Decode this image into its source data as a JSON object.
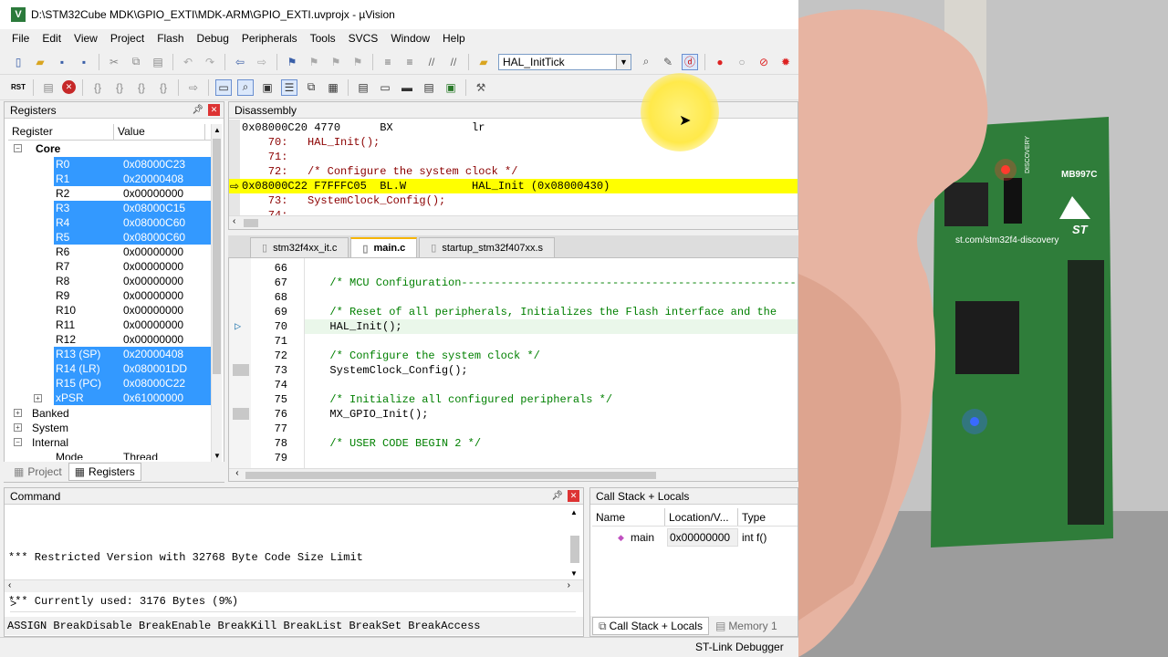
{
  "window": {
    "title": "D:\\STM32Cube MDK\\GPIO_EXTI\\MDK-ARM\\GPIO_EXTI.uvprojx - µVision",
    "app_icon": "V"
  },
  "menu": [
    "File",
    "Edit",
    "View",
    "Project",
    "Flash",
    "Debug",
    "Peripherals",
    "Tools",
    "SVCS",
    "Window",
    "Help"
  ],
  "toolbar": {
    "target_combo": "HAL_InitTick"
  },
  "registers": {
    "panel_title": "Registers",
    "col_register": "Register",
    "col_value": "Value",
    "group": "Core",
    "rows": [
      {
        "name": "R0",
        "value": "0x08000C23",
        "selected": true
      },
      {
        "name": "R1",
        "value": "0x20000408",
        "selected": true
      },
      {
        "name": "R2",
        "value": "0x00000000",
        "selected": false
      },
      {
        "name": "R3",
        "value": "0x08000C15",
        "selected": true
      },
      {
        "name": "R4",
        "value": "0x08000C60",
        "selected": true
      },
      {
        "name": "R5",
        "value": "0x08000C60",
        "selected": true
      },
      {
        "name": "R6",
        "value": "0x00000000",
        "selected": false
      },
      {
        "name": "R7",
        "value": "0x00000000",
        "selected": false
      },
      {
        "name": "R8",
        "value": "0x00000000",
        "selected": false
      },
      {
        "name": "R9",
        "value": "0x00000000",
        "selected": false
      },
      {
        "name": "R10",
        "value": "0x00000000",
        "selected": false
      },
      {
        "name": "R11",
        "value": "0x00000000",
        "selected": false
      },
      {
        "name": "R12",
        "value": "0x00000000",
        "selected": false
      },
      {
        "name": "R13 (SP)",
        "value": "0x20000408",
        "selected": true
      },
      {
        "name": "R14 (LR)",
        "value": "0x080001DD",
        "selected": true
      },
      {
        "name": "R15 (PC)",
        "value": "0x08000C22",
        "selected": true
      },
      {
        "name": "xPSR",
        "value": "0x61000000",
        "selected": true
      }
    ],
    "groups": [
      "Banked",
      "System",
      "Internal"
    ],
    "mode_label": "Mode",
    "mode_value": "Thread",
    "tabs": [
      "Project",
      "Registers"
    ]
  },
  "disassembly": {
    "title": "Disassembly",
    "lines": [
      "0x08000C20 4770      BX            lr",
      "    70:   HAL_Init();",
      "    71:",
      "    72:   /* Configure the system clock */",
      "0x08000C22 F7FFFC05  BL.W          HAL_Init (0x08000430)",
      "    73:   SystemClock_Config();",
      "    74:"
    ]
  },
  "editor": {
    "tabs": [
      "stm32f4xx_it.c",
      "main.c",
      "startup_stm32f407xx.s"
    ],
    "active_tab": "main.c",
    "lines": [
      {
        "n": "66",
        "code": ""
      },
      {
        "n": "67",
        "code": "  /* MCU Configuration----------------------------------------------------------"
      },
      {
        "n": "68",
        "code": ""
      },
      {
        "n": "69",
        "code": "  /* Reset of all peripherals, Initializes the Flash interface and the"
      },
      {
        "n": "70",
        "code": "  HAL_Init();"
      },
      {
        "n": "71",
        "code": ""
      },
      {
        "n": "72",
        "code": "  /* Configure the system clock */"
      },
      {
        "n": "73",
        "code": "  SystemClock_Config();"
      },
      {
        "n": "74",
        "code": ""
      },
      {
        "n": "75",
        "code": "  /* Initialize all configured peripherals */"
      },
      {
        "n": "76",
        "code": "  MX_GPIO_Init();"
      },
      {
        "n": "77",
        "code": ""
      },
      {
        "n": "78",
        "code": "  /* USER CODE BEGIN 2 */"
      },
      {
        "n": "79",
        "code": ""
      }
    ]
  },
  "command": {
    "title": "Command",
    "output": [
      "*** Restricted Version with 32768 Byte Code Size Limit",
      "*** Currently used: 3176 Bytes (9%)"
    ],
    "prompt": ">",
    "hint": "ASSIGN BreakDisable BreakEnable BreakKill BreakList BreakSet BreakAccess"
  },
  "callstack": {
    "title": "Call Stack + Locals",
    "cols": [
      "Name",
      "Location/V...",
      "Type"
    ],
    "row": {
      "name": "main",
      "location": "0x00000000",
      "type": "int f()"
    },
    "tabs": [
      "Call Stack + Locals",
      "Memory 1"
    ]
  },
  "status": {
    "debugger": "ST-Link Debugger"
  },
  "photo": {
    "board_label": "MB997C",
    "url_text": "st.com/stm32f4-discovery",
    "brand": "ST",
    "discovery": "DISCOVERY"
  },
  "colors": {
    "selection": "#3399ff",
    "current_line": "#ffff00",
    "comment": "#008000",
    "led_red": "#ff3b2f",
    "led_blue": "#3a6bff",
    "pcb": "#2f7d3a"
  }
}
